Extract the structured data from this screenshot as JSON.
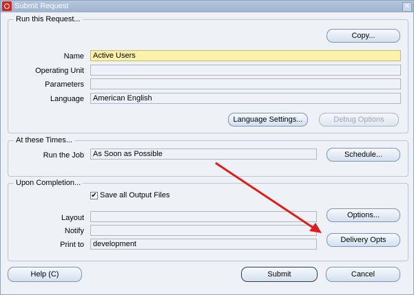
{
  "window": {
    "title": "Submit Request"
  },
  "run_request": {
    "group_title": "Run this Request...",
    "copy_button": "Copy...",
    "fields": {
      "name": {
        "label": "Name",
        "value": "Active Users"
      },
      "operating_unit": {
        "label": "Operating Unit",
        "value": ""
      },
      "parameters": {
        "label": "Parameters",
        "value": ""
      },
      "language": {
        "label": "Language",
        "value": "American English"
      }
    },
    "language_settings_button": "Language Settings...",
    "debug_options_button": "Debug Options"
  },
  "times": {
    "group_title": "At these Times...",
    "run_job_label": "Run the Job",
    "run_job_value": "As Soon as Possible",
    "schedule_button": "Schedule..."
  },
  "completion": {
    "group_title": "Upon Completion...",
    "save_output": {
      "label": "Save all Output Files",
      "checked": true
    },
    "layout": {
      "label": "Layout",
      "value": ""
    },
    "notify": {
      "label": "Notify",
      "value": ""
    },
    "print_to": {
      "label": "Print to",
      "value": "development"
    },
    "options_button": "Options...",
    "delivery_button": "Delivery Opts"
  },
  "footer": {
    "help_button": "Help (C)",
    "submit_button": "Submit",
    "cancel_button": "Cancel"
  },
  "colors": {
    "annotation_arrow": "#e01b1b",
    "required_field": "#fdf0a8",
    "titlebar": "#9db3cf"
  }
}
